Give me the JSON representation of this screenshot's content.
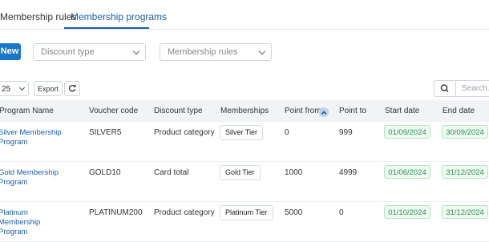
{
  "tabs": [
    {
      "label": "Membership rules",
      "active": false
    },
    {
      "label": "Membership programs",
      "active": true
    }
  ],
  "toolbar": {
    "new_label": "New",
    "discount_type_placeholder": "Discount type",
    "membership_rules_placeholder": "Membership rules"
  },
  "table_controls": {
    "page_size": "25",
    "export_label": "Export",
    "search_placeholder": "Search..."
  },
  "columns": [
    "Program Name",
    "Voucher code",
    "Discount type",
    "Memberships",
    "Point from",
    "Point to",
    "Start date",
    "End date"
  ],
  "rows": [
    {
      "name": "Silver Membership Program",
      "voucher": "SILVER5",
      "discount_type": "Product category",
      "membership": "Silver Tier",
      "point_from": "0",
      "point_to": "999",
      "start_date": "01/09/2024",
      "end_date": "30/09/2024"
    },
    {
      "name": "Gold Membership Program",
      "voucher": "GOLD10",
      "discount_type": "Card total",
      "membership": "Gold Tier",
      "point_from": "1000",
      "point_to": "4999",
      "start_date": "01/06/2024",
      "end_date": "31/12/2024"
    },
    {
      "name": "Platinum Membership Program",
      "voucher": "PLATINUM200",
      "discount_type": "Product category",
      "membership": "Platinum Tier",
      "point_from": "5000",
      "point_to": "0",
      "start_date": "01/10/2024",
      "end_date": "31/12/2024"
    }
  ],
  "colors": {
    "accent": "#1976c9",
    "link": "#1a5ea8",
    "date_badge_bg": "#eef9f1",
    "date_badge_text": "#2e8f4d"
  }
}
